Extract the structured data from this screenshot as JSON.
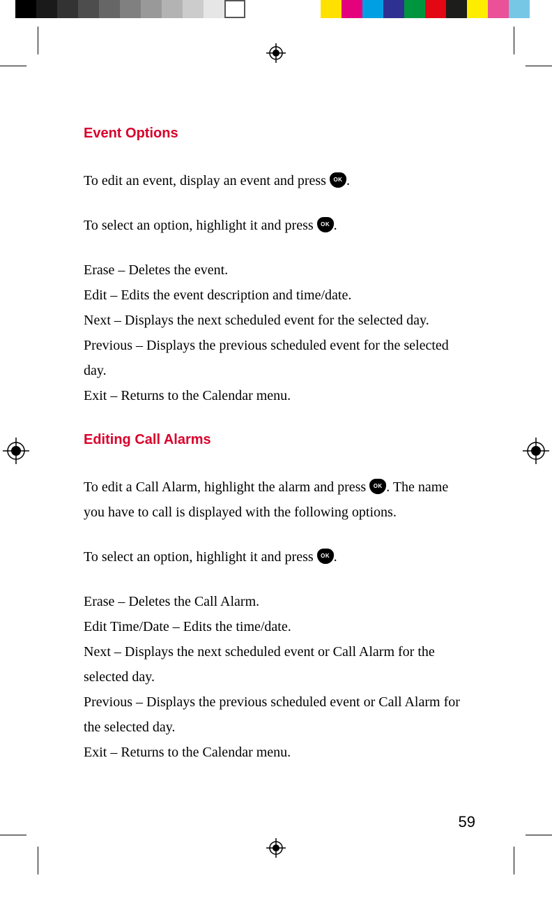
{
  "ok_label": "OK",
  "heading1": "Event Options",
  "p1a": "To edit an event, display an event and press ",
  "p1b": ".",
  "p2a": "To select an option, highlight it and press ",
  "p2b": ".",
  "event_options": {
    "erase": "Erase – Deletes the event.",
    "edit": "Edit – Edits the event description and time/date.",
    "next": "Next – Displays the next scheduled event for the selected day.",
    "previous": "Previous – Displays the previous scheduled event for the selected day.",
    "exit": "Exit – Returns to the Calendar menu."
  },
  "heading2": "Editing Call Alarms",
  "p3a": "To edit a Call Alarm, highlight the alarm and press ",
  "p3b": ". The name you have to call is displayed with the following options.",
  "p4a": "To select an option, highlight it and press ",
  "p4b": ".",
  "call_alarm_options": {
    "erase": "Erase – Deletes the Call Alarm.",
    "edit": "Edit Time/Date – Edits the time/date.",
    "next": "Next – Displays the next scheduled event or Call Alarm for the selected day.",
    "previous": "Previous – Displays the previous scheduled event or Call Alarm for the selected day.",
    "exit": "Exit – Returns to the Calendar menu."
  },
  "page_number": "59",
  "gray_swatches": [
    "#000000",
    "#1a1a1a",
    "#333333",
    "#4d4d4d",
    "#666666",
    "#808080",
    "#999999",
    "#b3b3b3",
    "#cccccc",
    "#e6e6e6",
    "#ffffff"
  ],
  "color_swatches": [
    "#ffe100",
    "#e5007e",
    "#009fe3",
    "#2e3192",
    "#009640",
    "#e30613",
    "#1d1d1b",
    "#ffed00",
    "#ea5198",
    "#76c7e6"
  ]
}
